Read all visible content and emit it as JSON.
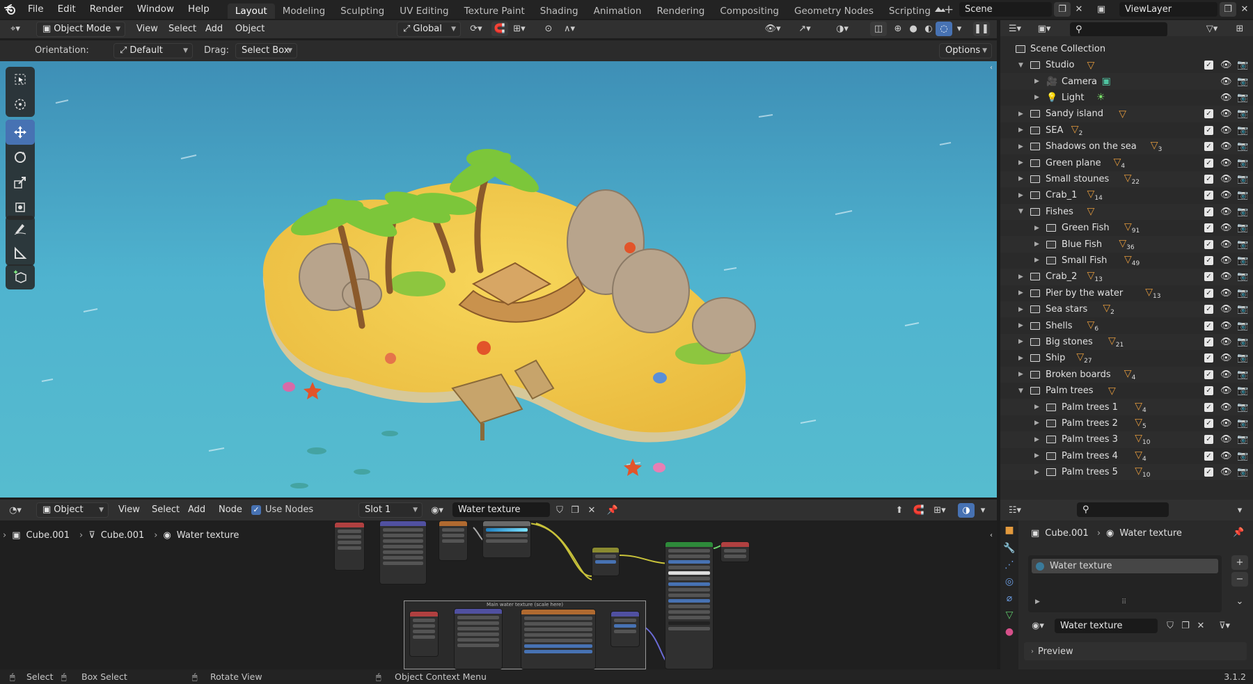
{
  "topbar": {
    "menus": [
      "File",
      "Edit",
      "Render",
      "Window",
      "Help"
    ],
    "workspaces": [
      "Layout",
      "Modeling",
      "Sculpting",
      "UV Editing",
      "Texture Paint",
      "Shading",
      "Animation",
      "Rendering",
      "Compositing",
      "Geometry Nodes",
      "Scripting"
    ],
    "active_workspace": "Layout",
    "add_workspace": "+",
    "scene": "Scene",
    "view_layer": "ViewLayer"
  },
  "viewport_header": {
    "mode": "Object Mode",
    "menus": [
      "View",
      "Select",
      "Add",
      "Object"
    ],
    "transform_orientation": "Global"
  },
  "tool_settings": {
    "orientation_label": "Orientation:",
    "orientation_value": "Default",
    "drag_label": "Drag:",
    "drag_value": "Select Box",
    "options": "Options"
  },
  "toolbox": [
    "select-box-tool",
    "cursor-tool",
    "move-tool",
    "rotate-tool",
    "scale-tool",
    "transform-tool",
    "annotate-tool",
    "measure-tool",
    "add-cube-tool"
  ],
  "active_tool": "move-tool",
  "outliner": {
    "root": "Scene Collection",
    "items": [
      {
        "name": "Studio",
        "depth": 0,
        "expanded": true,
        "type": "collection",
        "count": "",
        "checked": true
      },
      {
        "name": "Camera",
        "depth": 1,
        "expanded": false,
        "type": "camera",
        "count": "",
        "checked": false
      },
      {
        "name": "Light",
        "depth": 1,
        "expanded": false,
        "type": "light",
        "count": "",
        "checked": false
      },
      {
        "name": "Sandy island",
        "depth": 0,
        "expanded": false,
        "type": "collection",
        "count": "",
        "checked": true
      },
      {
        "name": "SEA",
        "depth": 0,
        "expanded": false,
        "type": "collection",
        "count": "2",
        "checked": true
      },
      {
        "name": "Shadows on the sea",
        "depth": 0,
        "expanded": false,
        "type": "collection",
        "count": "3",
        "checked": true
      },
      {
        "name": "Green plane",
        "depth": 0,
        "expanded": false,
        "type": "collection",
        "count": "4",
        "checked": true
      },
      {
        "name": "Small stounes",
        "depth": 0,
        "expanded": false,
        "type": "collection",
        "count": "22",
        "checked": true
      },
      {
        "name": "Crab_1",
        "depth": 0,
        "expanded": false,
        "type": "collection",
        "count": "14",
        "checked": true
      },
      {
        "name": "Fishes",
        "depth": 0,
        "expanded": true,
        "type": "collection",
        "count": "",
        "checked": true
      },
      {
        "name": "Green Fish",
        "depth": 1,
        "expanded": false,
        "type": "collection",
        "count": "91",
        "checked": true
      },
      {
        "name": "Blue Fish",
        "depth": 1,
        "expanded": false,
        "type": "collection",
        "count": "36",
        "checked": true
      },
      {
        "name": "Small Fish",
        "depth": 1,
        "expanded": false,
        "type": "collection",
        "count": "49",
        "checked": true
      },
      {
        "name": "Crab_2",
        "depth": 0,
        "expanded": false,
        "type": "collection",
        "count": "13",
        "checked": true
      },
      {
        "name": "Pier by the water",
        "depth": 0,
        "expanded": false,
        "type": "collection",
        "count": "13",
        "checked": true
      },
      {
        "name": "Sea stars",
        "depth": 0,
        "expanded": false,
        "type": "collection",
        "count": "2",
        "checked": true
      },
      {
        "name": "Shells",
        "depth": 0,
        "expanded": false,
        "type": "collection",
        "count": "6",
        "checked": true
      },
      {
        "name": "Big stones",
        "depth": 0,
        "expanded": false,
        "type": "collection",
        "count": "21",
        "checked": true
      },
      {
        "name": "Ship",
        "depth": 0,
        "expanded": false,
        "type": "collection",
        "count": "27",
        "checked": true
      },
      {
        "name": "Broken boards",
        "depth": 0,
        "expanded": false,
        "type": "collection",
        "count": "4",
        "checked": true
      },
      {
        "name": "Palm trees",
        "depth": 0,
        "expanded": true,
        "type": "collection",
        "count": "",
        "checked": true
      },
      {
        "name": "Palm trees 1",
        "depth": 1,
        "expanded": false,
        "type": "collection",
        "count": "4",
        "checked": true
      },
      {
        "name": "Palm trees 2",
        "depth": 1,
        "expanded": false,
        "type": "collection",
        "count": "5",
        "checked": true
      },
      {
        "name": "Palm trees 3",
        "depth": 1,
        "expanded": false,
        "type": "collection",
        "count": "10",
        "checked": true
      },
      {
        "name": "Palm trees 4",
        "depth": 1,
        "expanded": false,
        "type": "collection",
        "count": "4",
        "checked": true
      },
      {
        "name": "Palm trees 5",
        "depth": 1,
        "expanded": false,
        "type": "collection",
        "count": "10",
        "checked": true
      }
    ]
  },
  "node_editor": {
    "type": "Object",
    "menus": [
      "View",
      "Select",
      "Add",
      "Node"
    ],
    "use_nodes_label": "Use Nodes",
    "use_nodes": true,
    "slot": "Slot 1",
    "material": "Water texture",
    "breadcrumb": [
      "Cube.001",
      "Cube.001",
      "Water texture"
    ],
    "frame_label": "Main water texture (scale here)"
  },
  "properties": {
    "breadcrumb": [
      "Cube.001",
      "Water texture"
    ],
    "slots": [
      "Water texture"
    ],
    "material": "Water texture",
    "preview_label": "Preview"
  },
  "statusbar": {
    "items": [
      "Select",
      "Box Select",
      "Rotate View",
      "Object Context Menu"
    ],
    "version": "3.1.2"
  },
  "colors": {
    "accent": "#4772b3",
    "object_badge": "#e39a3d",
    "header": "#303030",
    "panel": "#2a2a2a"
  }
}
